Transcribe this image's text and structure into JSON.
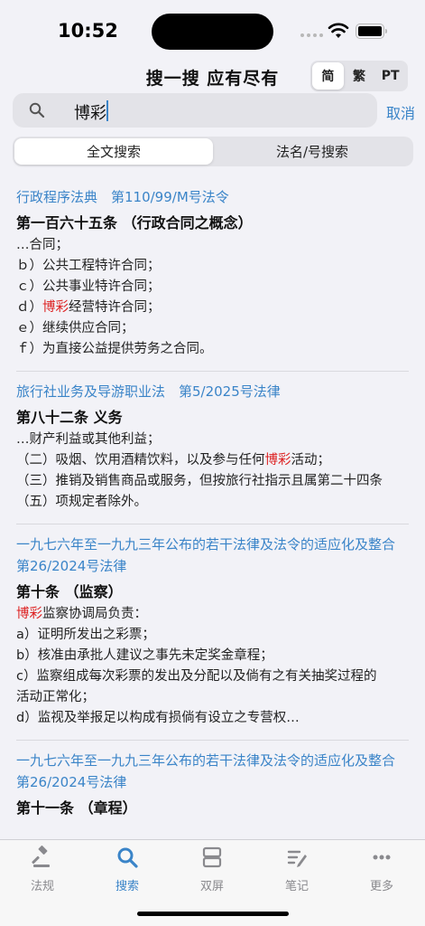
{
  "status": {
    "time": "10:52"
  },
  "header": {
    "title": "搜一搜 应有尽有"
  },
  "lang_options": [
    "简",
    "繁",
    "PT"
  ],
  "search": {
    "query": "博彩",
    "cancel_label": "取消"
  },
  "mode_tabs": [
    "全文搜索",
    "法名/号搜索"
  ],
  "colors": {
    "accent": "#3a84c8",
    "highlight": "#d22222"
  },
  "results": [
    {
      "law": "行政程序法典　第110/99/M号法令",
      "article": "第一百六十五条 （行政合同之概念）",
      "lines": [
        [
          {
            "t": "…合同；"
          }
        ],
        [
          {
            "t": "ｂ）公共工程特许合同；"
          }
        ],
        [
          {
            "t": "ｃ）公共事业特许合同；"
          }
        ],
        [
          {
            "t": "ｄ）"
          },
          {
            "t": "博彩",
            "h": true
          },
          {
            "t": "经营特许合同；"
          }
        ],
        [
          {
            "t": "ｅ）继续供应合同；"
          }
        ],
        [
          {
            "t": "ｆ）为直接公益提供劳务之合同。"
          }
        ]
      ]
    },
    {
      "law": "旅行社业务及导游职业法　第5/2025号法律",
      "article": "第八十二条 义务",
      "lines": [
        [
          {
            "t": "…财产利益或其他利益；"
          }
        ],
        [
          {
            "t": "（二）吸烟、饮用酒精饮料，以及参与任何"
          },
          {
            "t": "博彩",
            "h": true
          },
          {
            "t": "活动；"
          }
        ],
        [
          {
            "t": "（三）推销及销售商品或服务，但按旅行社指示且属第二十四条"
          }
        ],
        [
          {
            "t": "（五）项规定者除外。"
          }
        ]
      ]
    },
    {
      "law": "一九七六年至一九九三年公布的若干法律及法令的适应化及整合　第26/2024号法律",
      "article": "第十条 （监察）",
      "lines": [
        [
          {
            "t": "博彩",
            "h": true
          },
          {
            "t": "监察协调局负责："
          }
        ],
        [
          {
            "t": "a）证明所发出之彩票；"
          }
        ],
        [
          {
            "t": "b）核准由承批人建议之事先未定奖金章程；"
          }
        ],
        [
          {
            "t": "c）监察组成每次彩票的发出及分配以及倘有之有关抽奖过程的"
          }
        ],
        [
          {
            "t": "活动正常化；"
          }
        ],
        [
          {
            "t": "d）监视及举报足以构成有损倘有设立之专营权…"
          }
        ]
      ]
    },
    {
      "law": "一九七六年至一九九三年公布的若干法律及法令的适应化及整合　第26/2024号法律",
      "article": "第十一条 （章程）",
      "lines": []
    }
  ],
  "tabbar": [
    {
      "label": "法规",
      "icon": "gavel-icon"
    },
    {
      "label": "搜索",
      "icon": "search-icon"
    },
    {
      "label": "双屏",
      "icon": "split-screen-icon"
    },
    {
      "label": "笔记",
      "icon": "notes-icon"
    },
    {
      "label": "更多",
      "icon": "more-icon"
    }
  ]
}
